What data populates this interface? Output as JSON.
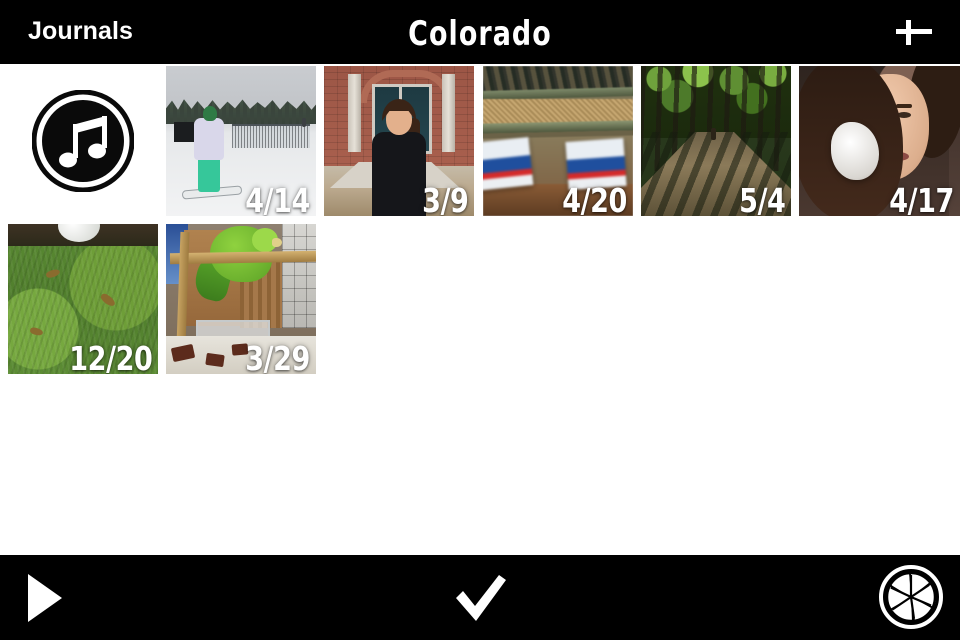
{
  "app": {
    "background_color": "#ffffff",
    "bar_color": "#000000",
    "accent_color": "#ffffff"
  },
  "header": {
    "back_label": "Journals",
    "title": "Colorado",
    "add_icon": "plus-icon"
  },
  "grid": {
    "items": [
      {
        "kind": "audio",
        "icon": "music-note-icon",
        "date": "",
        "scene": "audio",
        "alt": "music note badge"
      },
      {
        "kind": "photo",
        "icon": "photo",
        "date": "4/14",
        "scene": "sc-snow",
        "alt": "snowboarder on a ski slope"
      },
      {
        "kind": "photo",
        "icon": "photo",
        "date": "3/9",
        "scene": "sc-house",
        "alt": "woman smiling in front of a brick house"
      },
      {
        "kind": "photo",
        "icon": "photo",
        "date": "4/20",
        "scene": "sc-conveyor",
        "alt": "blurry boxes on a conveyor"
      },
      {
        "kind": "photo",
        "icon": "photo",
        "date": "5/4",
        "scene": "sc-forest",
        "alt": "dirt road through a forest"
      },
      {
        "kind": "photo",
        "icon": "photo",
        "date": "4/17",
        "scene": "sc-face",
        "alt": "close-up of a woman holding a tissue"
      },
      {
        "kind": "photo",
        "icon": "photo",
        "date": "12/20",
        "scene": "sc-grass",
        "alt": "green grass with fallen leaves"
      },
      {
        "kind": "photo",
        "icon": "photo",
        "date": "3/29",
        "scene": "sc-parrot",
        "alt": "green parrot on a wooden perch"
      }
    ]
  },
  "toolbar": {
    "play_label": "play-icon",
    "done_label": "checkmark-icon",
    "camera_label": "camera-aperture-icon"
  }
}
